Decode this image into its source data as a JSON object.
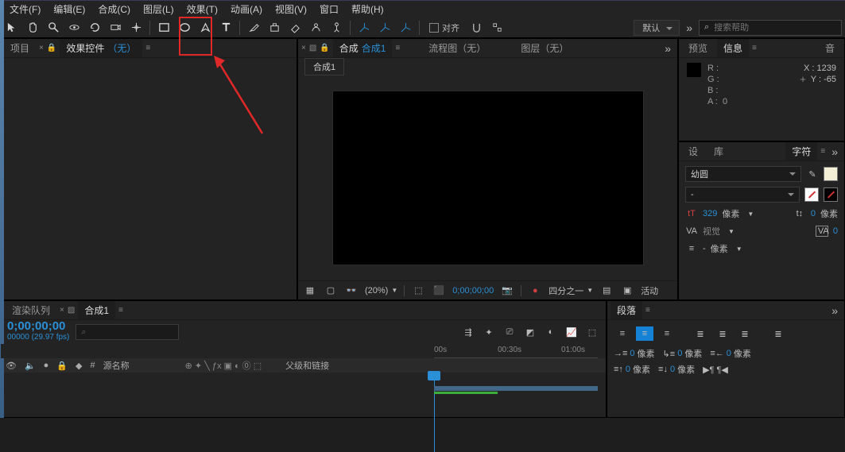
{
  "menu": {
    "items": [
      "文件(F)",
      "编辑(E)",
      "合成(C)",
      "图层(L)",
      "效果(T)",
      "动画(A)",
      "视图(V)",
      "窗口",
      "帮助(H)"
    ]
  },
  "toolbar": {
    "align_label": "对齐",
    "workspace": "默认",
    "search_placeholder": "搜索帮助"
  },
  "project": {
    "tab1": "项目",
    "tab2_prefix": "效果控件",
    "tab2_none": "（无）"
  },
  "comp": {
    "tab_label": "合成",
    "tab_name": "合成1",
    "flow_label": "流程图（无）",
    "layer_label": "图层（无）",
    "sub_tab": "合成1",
    "zoom": "(20%)",
    "time": "0;00;00;00",
    "quality": "四分之一",
    "active": "活动"
  },
  "info": {
    "tab_preview": "预览",
    "tab_info": "信息",
    "tab_audio": "音",
    "R": "R :",
    "G": "G :",
    "B": "B :",
    "A": "A :",
    "A_val": "0",
    "X": "X : ",
    "X_val": "1239",
    "Y": "Y : ",
    "Y_val": "-65"
  },
  "char": {
    "tab_set": "设",
    "tab_lib": "库",
    "tab_char": "字符",
    "font": "幼圆",
    "style": "-",
    "size_label": "像素",
    "size_val": "329",
    "leading_label": "像素",
    "leading_val": "0",
    "tracking_label": "视觉",
    "kerning_val": "0",
    "stroke_label": "像素",
    "stroke_dash": "-"
  },
  "timeline": {
    "tab_render": "渲染队列",
    "tab_comp": "合成1",
    "timecode": "0;00;00;00",
    "fps": "00000 (29.97 fps)",
    "col_source": "源名称",
    "col_parent": "父级和链接",
    "r_00s": "00s",
    "r_030": "00:30s",
    "r_100": "01:00s"
  },
  "para": {
    "tab": "段落",
    "px": "像素",
    "zero": "0"
  }
}
